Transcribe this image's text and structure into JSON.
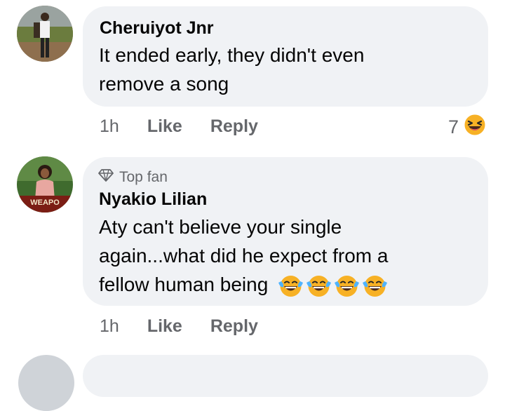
{
  "comments": [
    {
      "author": "Cheruiyot Jnr",
      "lines": [
        "It ended early, they didn't even",
        "remove a song"
      ],
      "time": "1h",
      "like": "Like",
      "reply": "Reply",
      "reaction_count": "7",
      "reaction_icon": "laughing-emoji-icon"
    },
    {
      "badge": "Top fan",
      "badge_icon": "diamond-icon",
      "author": "Nyakio Lilian",
      "lines": [
        "Aty can't believe your single",
        "again...what did he expect from a",
        "fellow human being"
      ],
      "line_emojis": [
        "tears-of-joy-emoji-icon",
        "tears-of-joy-emoji-icon",
        "tears-of-joy-emoji-icon",
        "tears-of-joy-emoji-icon"
      ],
      "avatar_caption": "WEAPO",
      "time": "1h",
      "like": "Like",
      "reply": "Reply"
    }
  ],
  "colors": {
    "bubble": "#f0f2f5",
    "secondary_text": "#65676b",
    "primary_text": "#050505",
    "emoji_yellow": "#f7b125"
  }
}
